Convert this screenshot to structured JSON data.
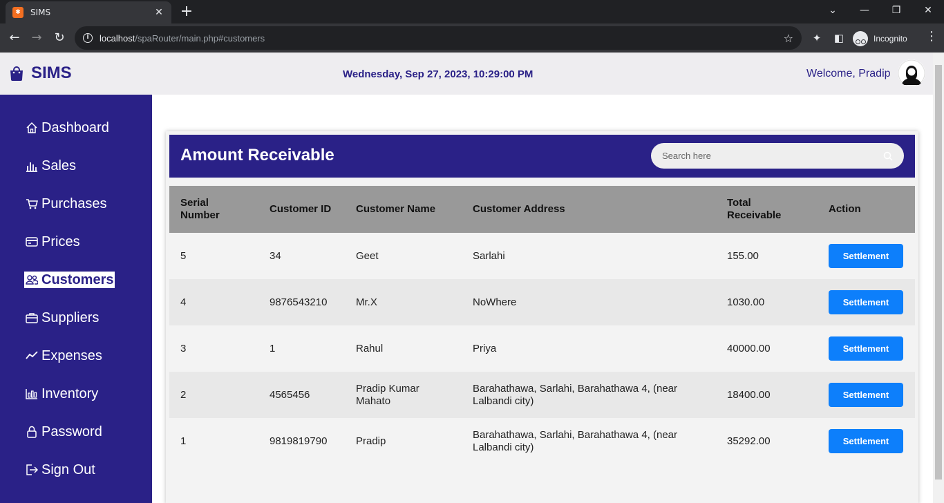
{
  "browser": {
    "tab_title": "SIMS",
    "url_host": "localhost",
    "url_path": "/spaRouter/main.php#customers",
    "profile_label": "Incognito"
  },
  "header": {
    "brand": "SIMS",
    "datetime": "Wednesday, Sep 27, 2023, 10:29:00 PM",
    "welcome": "Welcome, Pradip"
  },
  "sidebar": {
    "items": [
      {
        "label": "Dashboard",
        "icon": "home-icon"
      },
      {
        "label": "Sales",
        "icon": "bar-chart-icon"
      },
      {
        "label": "Purchases",
        "icon": "cart-icon"
      },
      {
        "label": "Prices",
        "icon": "card-icon"
      },
      {
        "label": "Customers",
        "icon": "people-icon",
        "active": true
      },
      {
        "label": "Suppliers",
        "icon": "briefcase-icon"
      },
      {
        "label": "Expenses",
        "icon": "trend-icon"
      },
      {
        "label": "Inventory",
        "icon": "inventory-icon"
      },
      {
        "label": "Password",
        "icon": "lock-icon"
      },
      {
        "label": "Sign Out",
        "icon": "sign-out-icon"
      }
    ]
  },
  "main": {
    "title": "Amount Receivable",
    "search_placeholder": "Search here",
    "columns": [
      "Serial Number",
      "Customer ID",
      "Customer Name",
      "Customer Address",
      "Total Receivable",
      "Action"
    ],
    "rows": [
      {
        "serial": "5",
        "id": "34",
        "name": "Geet",
        "address": "Sarlahi",
        "total": "155.00",
        "action": "Settlement"
      },
      {
        "serial": "4",
        "id": "9876543210",
        "name": "Mr.X",
        "address": "NoWhere",
        "total": "1030.00",
        "action": "Settlement"
      },
      {
        "serial": "3",
        "id": "1",
        "name": "Rahul",
        "address": "Priya",
        "total": "40000.00",
        "action": "Settlement"
      },
      {
        "serial": "2",
        "id": "4565456",
        "name": "Pradip Kumar Mahato",
        "address": "Barahathawa, Sarlahi, Barahathawa 4, (near Lalbandi city)",
        "total": "18400.00",
        "action": "Settlement"
      },
      {
        "serial": "1",
        "id": "9819819790",
        "name": "Pradip",
        "address": "Barahathawa, Sarlahi, Barahathawa 4, (near Lalbandi city)",
        "total": "35292.00",
        "action": "Settlement"
      }
    ]
  },
  "colors": {
    "brand": "#2a2187",
    "header_bg": "#eeedf0",
    "table_head": "#999999",
    "button": "#0d7ffb"
  }
}
